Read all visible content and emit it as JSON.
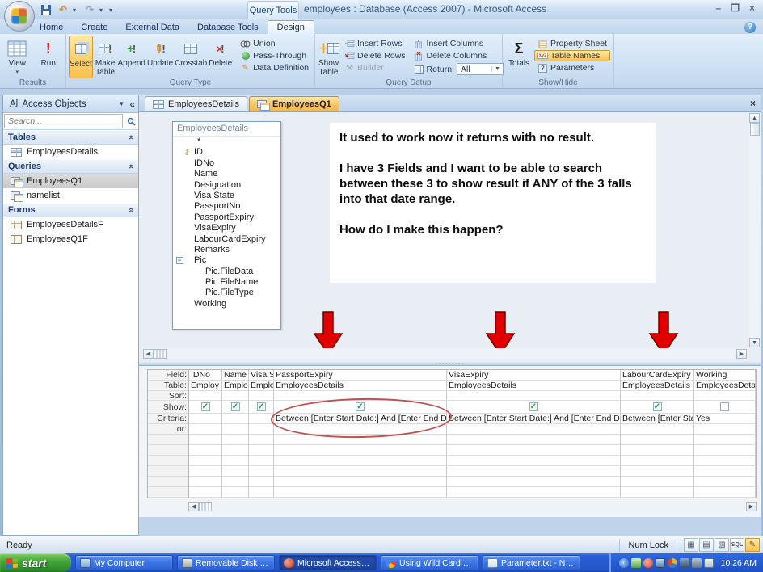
{
  "titlebar": {
    "contextual_label": "Query Tools",
    "title": "employees : Database (Access 2007) - Microsoft Access"
  },
  "ribbon_tabs": {
    "home": "Home",
    "create": "Create",
    "external_data": "External Data",
    "database_tools": "Database Tools",
    "design": "Design"
  },
  "ribbon": {
    "results": {
      "label": "Results",
      "view": "View",
      "run": "Run"
    },
    "query_type": {
      "label": "Query Type",
      "select": "Select",
      "make_table": "Make Table",
      "append": "Append",
      "update": "Update",
      "crosstab": "Crosstab",
      "delete": "Delete",
      "union": "Union",
      "pass_through": "Pass-Through",
      "data_definition": "Data Definition"
    },
    "query_setup": {
      "label": "Query Setup",
      "show_table": "Show Table",
      "insert_rows": "Insert Rows",
      "delete_rows": "Delete Rows",
      "builder": "Builder",
      "insert_columns": "Insert Columns",
      "delete_columns": "Delete Columns",
      "return_label": "Return:",
      "return_value": "All"
    },
    "show_hide": {
      "label": "Show/Hide",
      "totals": "Totals",
      "property_sheet": "Property Sheet",
      "table_names": "Table Names",
      "parameters": "Parameters"
    }
  },
  "sidebar": {
    "header": "All Access Objects",
    "search_placeholder": "Search...",
    "sections": [
      {
        "title": "Tables",
        "items": [
          {
            "label": "EmployeesDetails"
          }
        ]
      },
      {
        "title": "Queries",
        "items": [
          {
            "label": "EmployeesQ1"
          },
          {
            "label": "namelist"
          }
        ]
      },
      {
        "title": "Forms",
        "items": [
          {
            "label": "EmployeesDetailsF"
          },
          {
            "label": "EmployeesQ1F"
          }
        ]
      }
    ]
  },
  "doc_tabs": {
    "tab1": "EmployeesDetails",
    "tab2": "EmployeesQ1"
  },
  "field_list": {
    "title": "EmployeesDetails",
    "fields": [
      {
        "label": "*"
      },
      {
        "label": "ID"
      },
      {
        "label": "IDNo"
      },
      {
        "label": "Name"
      },
      {
        "label": "Designation"
      },
      {
        "label": "Visa State"
      },
      {
        "label": "PassportNo"
      },
      {
        "label": "PassportExpiry"
      },
      {
        "label": "VisaExpiry"
      },
      {
        "label": "LabourCardExpiry"
      },
      {
        "label": "Remarks"
      },
      {
        "label": "Pic"
      },
      {
        "label": "Pic.FileData"
      },
      {
        "label": "Pic.FileName"
      },
      {
        "label": "Pic.FileType"
      },
      {
        "label": "Working"
      }
    ]
  },
  "note": {
    "p1": "It used to work now it returns with no result.",
    "p2": "I have 3 Fields and I want to be able to search between these 3 to show result if ANY of the 3 falls into that date range.",
    "p3": "How do I make this happen?"
  },
  "grid": {
    "row_labels": {
      "field": "Field:",
      "table": "Table:",
      "sort": "Sort:",
      "show": "Show:",
      "criteria": "Criteria:",
      "or": "or:"
    },
    "columns": [
      {
        "field": "IDNo",
        "table": "Employ",
        "show": true,
        "criteria": ""
      },
      {
        "field": "Name",
        "table": "Emplo",
        "show": true,
        "criteria": ""
      },
      {
        "field": "Visa Sta",
        "table": "Employ",
        "show": true,
        "criteria": ""
      },
      {
        "field": "PassportExpiry",
        "table": "EmployeesDetails",
        "show": true,
        "criteria": "Between [Enter Start Date:] And [Enter End Date:]"
      },
      {
        "field": "VisaExpiry",
        "table": "EmployeesDetails",
        "show": true,
        "criteria": "Between [Enter Start Date:] And [Enter End Date:]"
      },
      {
        "field": "LabourCardExpiry",
        "table": "EmployeesDetails",
        "show": true,
        "criteria": "Between [Enter Start I"
      },
      {
        "field": "Working",
        "table": "EmployeesDetails",
        "show": false,
        "criteria": "Yes"
      }
    ]
  },
  "status_bar": {
    "message": "Ready",
    "num_lock": "Num Lock",
    "sql_label": "SQL"
  },
  "taskbar": {
    "start_label": "start",
    "tasks": [
      {
        "label": "My Computer"
      },
      {
        "label": "Removable Disk (I:)"
      },
      {
        "label": "Microsoft Access - em..."
      },
      {
        "label": "Using Wild Card Entri..."
      },
      {
        "label": "Parameter.txt - Note..."
      }
    ],
    "clock": "10:26 AM"
  },
  "colors": {
    "ribbon_highlight": "#fbc14e",
    "arrow_red": "#e00000",
    "ellipse_red": "#c0504d",
    "taskbar_blue": "#2a5ed8",
    "start_green": "#43a33a"
  }
}
